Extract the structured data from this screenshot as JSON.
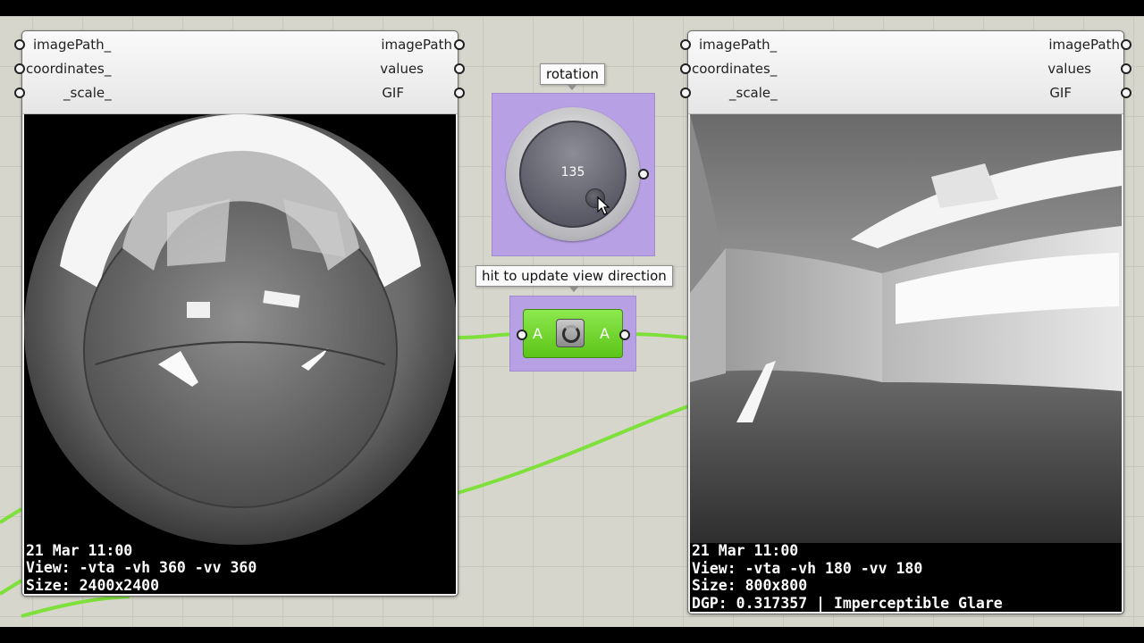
{
  "left_viewer": {
    "inputs": [
      "imagePath_",
      "coordinates_",
      "_scale_"
    ],
    "outputs": [
      "imagePath",
      "values",
      "GIF"
    ],
    "overlay": {
      "line1": "21 Mar 11:00",
      "line2": "View: -vta -vh 360 -vv 360",
      "line3": "Size: 2400x2400"
    }
  },
  "right_viewer": {
    "inputs": [
      "imagePath_",
      "coordinates_",
      "_scale_"
    ],
    "outputs": [
      "imagePath",
      "values",
      "GIF"
    ],
    "overlay": {
      "line1": "21 Mar 11:00",
      "line2": "View: -vta -vh 180 -vv 180",
      "line3": "Size: 800x800",
      "line4": "DGP: 0.317357 | Imperceptible Glare"
    }
  },
  "rotation_slider": {
    "tooltip": "rotation",
    "value": "135"
  },
  "update_button": {
    "tooltip": "hit to update view direction",
    "input_label": "A",
    "output_label": "A"
  },
  "colors": {
    "canvas": "#d6d6cc",
    "wire": "#7ee03a",
    "group_purple": "#b7a0e3",
    "button_green": "#5cc417"
  }
}
